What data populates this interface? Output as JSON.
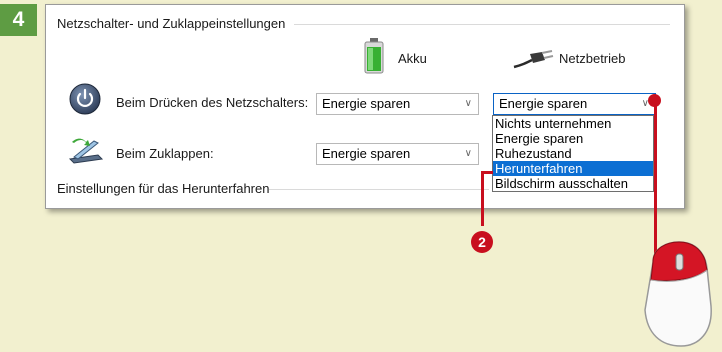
{
  "step_number": "4",
  "group_title": "Netzschalter- und Zuklappeinstellungen",
  "columns": {
    "battery_label": "Akku",
    "power_label": "Netzbetrieb"
  },
  "rows": [
    {
      "label": "Beim Drücken des Netzschalters:",
      "battery_value": "Energie sparen",
      "power_value": "Energie sparen"
    },
    {
      "label": "Beim Zuklappen:",
      "battery_value": "Energie sparen",
      "power_value": ""
    }
  ],
  "dropdown_options": [
    "Nichts unternehmen",
    "Energie sparen",
    "Ruhezustand",
    "Herunterfahren",
    "Bildschirm ausschalten"
  ],
  "dropdown_selected": "Herunterfahren",
  "shutdown_section_title": "Einstellungen für das Herunterfahren",
  "callout_number": "2",
  "colors": {
    "background": "#f2f0cf",
    "step_badge": "#5e9c43",
    "callout": "#c80f1e",
    "selection": "#0c6fd3"
  }
}
